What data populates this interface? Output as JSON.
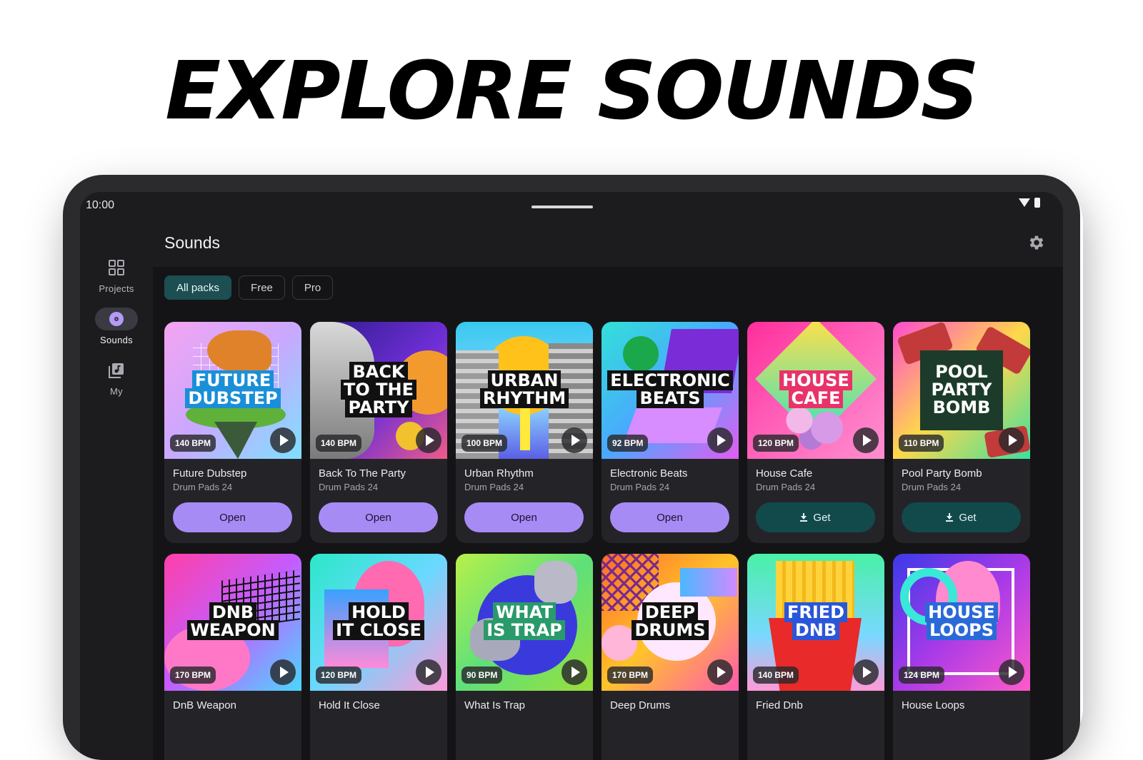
{
  "headline": "EXPLORE SOUNDS",
  "status_bar": {
    "time": "10:00"
  },
  "nav": [
    {
      "label": "Projects",
      "icon": "grid-icon",
      "active": false
    },
    {
      "label": "Sounds",
      "icon": "vinyl-icon",
      "active": true
    },
    {
      "label": "My",
      "icon": "music-library-icon",
      "active": false
    }
  ],
  "page": {
    "title": "Sounds",
    "settings_icon": "gear-icon"
  },
  "filters": [
    {
      "label": "All packs",
      "active": true
    },
    {
      "label": "Free",
      "active": false
    },
    {
      "label": "Pro",
      "active": false
    }
  ],
  "colors": {
    "accent": "#a78bf5",
    "get_button": "#124a4c",
    "active_chip": "#1c4e52"
  },
  "packs": [
    {
      "cover_title": "FUTURE\nDUBSTEP",
      "bpm": "140 BPM",
      "name": "Future Dubstep",
      "subtitle": "Drum Pads 24",
      "action": "Open"
    },
    {
      "cover_title": "BACK\nTO THE\nPARTY",
      "bpm": "140 BPM",
      "name": "Back To The Party",
      "subtitle": "Drum Pads 24",
      "action": "Open"
    },
    {
      "cover_title": "URBAN\nRHYTHM",
      "bpm": "100 BPM",
      "name": "Urban Rhythm",
      "subtitle": "Drum Pads 24",
      "action": "Open"
    },
    {
      "cover_title": "ELECTRONIC\nBEATS",
      "bpm": "92 BPM",
      "name": "Electronic Beats",
      "subtitle": "Drum Pads 24",
      "action": "Open"
    },
    {
      "cover_title": "HOUSE\nCAFE",
      "bpm": "120 BPM",
      "name": "House Cafe",
      "subtitle": "Drum Pads 24",
      "action": "Get"
    },
    {
      "cover_title": "POOL\nPARTY\nBOMB",
      "bpm": "110 BPM",
      "name": "Pool Party Bomb",
      "subtitle": "Drum Pads 24",
      "action": "Get"
    },
    {
      "cover_title": "DNB\nWEAPON",
      "bpm": "170 BPM",
      "name": "DnB Weapon",
      "subtitle": "",
      "action": ""
    },
    {
      "cover_title": "HOLD\nIT CLOSE",
      "bpm": "120 BPM",
      "name": "Hold It Close",
      "subtitle": "",
      "action": ""
    },
    {
      "cover_title": "WHAT\nIS TRAP",
      "bpm": "90 BPM",
      "name": "What Is Trap",
      "subtitle": "",
      "action": ""
    },
    {
      "cover_title": "DEEP\nDRUMS",
      "bpm": "170 BPM",
      "name": "Deep Drums",
      "subtitle": "",
      "action": ""
    },
    {
      "cover_title": "FRIED\nDNB",
      "bpm": "140 BPM",
      "name": "Fried Dnb",
      "subtitle": "",
      "action": ""
    },
    {
      "cover_title": "HOUSE\nLOOPS",
      "bpm": "124 BPM",
      "name": "House Loops",
      "subtitle": "",
      "action": ""
    }
  ]
}
